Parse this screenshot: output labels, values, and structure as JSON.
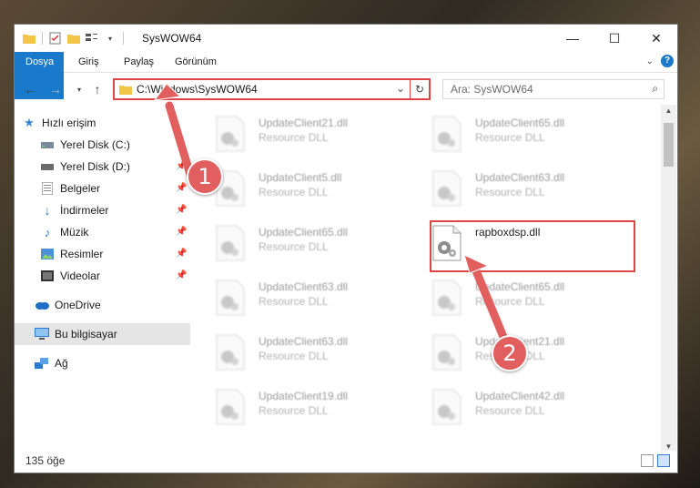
{
  "window": {
    "title": "SysWOW64"
  },
  "ribbon": {
    "tabs": [
      "Dosya",
      "Giriş",
      "Paylaş",
      "Görünüm"
    ],
    "help": "?"
  },
  "address": {
    "path": "C:\\Windows\\SysWOW64"
  },
  "search": {
    "placeholder": "Ara: SysWOW64"
  },
  "sidebar": {
    "items": [
      {
        "label": "Hızlı erişim",
        "icon": "star-icon"
      },
      {
        "label": "Yerel Disk (C:)",
        "icon": "drive-icon"
      },
      {
        "label": "Yerel Disk (D:)",
        "icon": "drive-icon"
      },
      {
        "label": "Belgeler",
        "icon": "documents-icon"
      },
      {
        "label": "İndirmeler",
        "icon": "download-icon"
      },
      {
        "label": "Müzik",
        "icon": "music-icon"
      },
      {
        "label": "Resimler",
        "icon": "pictures-icon"
      },
      {
        "label": "Videolar",
        "icon": "video-icon"
      },
      {
        "label": "OneDrive",
        "icon": "cloud-icon"
      },
      {
        "label": "Bu bilgisayar",
        "icon": "computer-icon"
      },
      {
        "label": "Ağ",
        "icon": "network-icon"
      }
    ]
  },
  "files": [
    {
      "name": "UpdateClient21.dll",
      "type": "Resource DLL"
    },
    {
      "name": "UpdateClient65.dll",
      "type": "Resource DLL"
    },
    {
      "name": "UpdateClient5.dll",
      "type": "Resource DLL"
    },
    {
      "name": "UpdateClient63.dll",
      "type": "Resource DLL"
    },
    {
      "name": "UpdateClient65.dll",
      "type": "Resource DLL"
    },
    {
      "name": "rapboxdsp.dll",
      "type": ""
    },
    {
      "name": "UpdateClient63.dll",
      "type": "Resource DLL"
    },
    {
      "name": "UpdateClient65.dll",
      "type": "Resource DLL"
    },
    {
      "name": "UpdateClient63.dll",
      "type": "Resource DLL"
    },
    {
      "name": "UpdateClient21.dll",
      "type": "Resource DLL"
    },
    {
      "name": "UpdateClient19.dll",
      "type": "Resource DLL"
    },
    {
      "name": "UpdateClient42.dll",
      "type": "Resource DLL"
    }
  ],
  "status": {
    "count": "135 öğe"
  },
  "annotations": {
    "badge1": "1",
    "badge2": "2"
  },
  "colors": {
    "accent": "#1979ca",
    "highlight": "#e04545",
    "badge": "#e25f5f"
  }
}
